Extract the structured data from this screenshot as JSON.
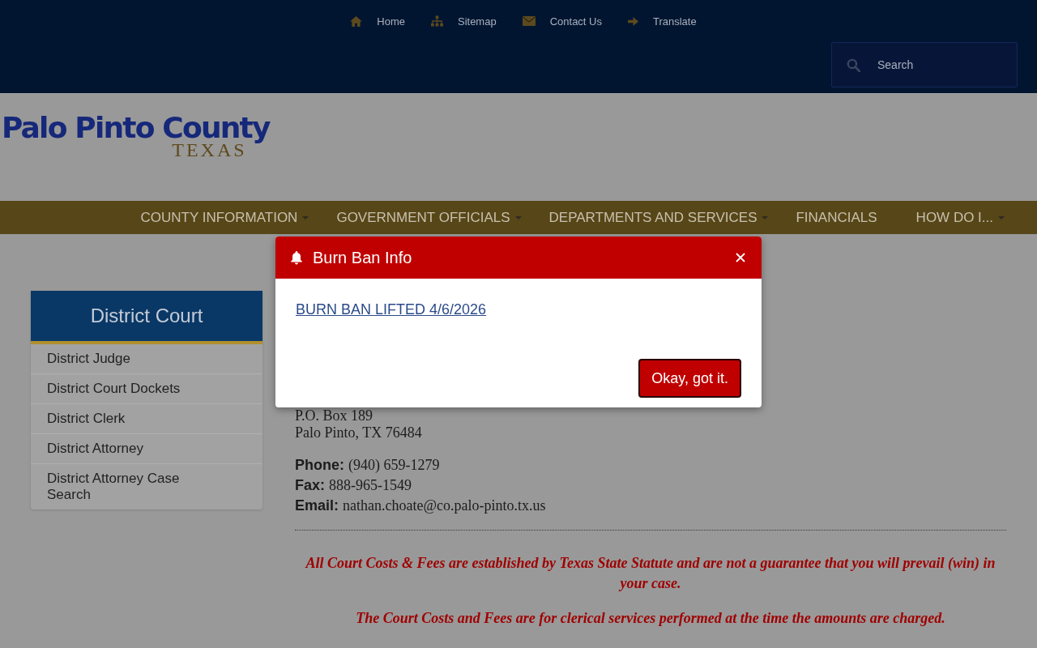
{
  "top_links": [
    {
      "label": "Home"
    },
    {
      "label": "Sitemap"
    },
    {
      "label": "Contact Us"
    },
    {
      "label": "Translate"
    }
  ],
  "search": {
    "placeholder": "Search"
  },
  "logo": {
    "title": "Palo Pinto County",
    "subtitle": "TEXAS"
  },
  "nav": [
    {
      "label": "COUNTY INFORMATION",
      "dropdown": true
    },
    {
      "label": "GOVERNMENT OFFICIALS",
      "dropdown": true
    },
    {
      "label": "DEPARTMENTS AND SERVICES",
      "dropdown": true
    },
    {
      "label": "FINANCIALS",
      "dropdown": false
    },
    {
      "label": "HOW DO I...",
      "dropdown": true
    }
  ],
  "sidebar": {
    "title": "District Court",
    "items": [
      "District Judge",
      "District Court Dockets",
      "District Clerk",
      "District Attorney",
      "District Attorney Case Search"
    ]
  },
  "contact": {
    "address": [
      "P.O. Box 189",
      "Palo Pinto, TX 76484"
    ],
    "fields": [
      {
        "label": "Phone:",
        "value": "(940) 659-1279"
      },
      {
        "label": "Fax:",
        "value": "888-965-1549"
      },
      {
        "label": "Email:",
        "value": "nathan.choate@co.palo-pinto.tx.us"
      }
    ]
  },
  "notices": [
    "All Court Costs & Fees are established by Texas State Statute and are not a guarantee that you will prevail (win) in your case.",
    "The Court Costs and Fees are for clerical services performed at the time the amounts are charged."
  ],
  "dialog": {
    "title": "Burn Ban Info",
    "link": "BURN BAN LIFTED 4/6/2026",
    "button": "Okay, got it."
  }
}
